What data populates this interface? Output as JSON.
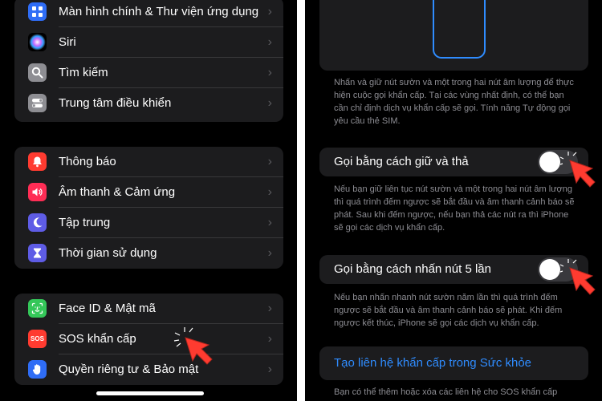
{
  "left_settings": {
    "group1": [
      {
        "label": "Màn hình chính & Thư viện ứng dụng",
        "icon": "home-screen-icon",
        "color": "#2f6df6"
      },
      {
        "label": "Siri",
        "icon": "siri-icon",
        "color": "#000000"
      },
      {
        "label": "Tìm kiếm",
        "icon": "search-icon",
        "color": "#8e8e93"
      },
      {
        "label": "Trung tâm điều khiển",
        "icon": "control-center-icon",
        "color": "#8e8e93"
      }
    ],
    "group2": [
      {
        "label": "Thông báo",
        "icon": "bell-icon",
        "color": "#ff3b30"
      },
      {
        "label": "Âm thanh & Cảm ứng",
        "icon": "speaker-icon",
        "color": "#ff2d55"
      },
      {
        "label": "Tập trung",
        "icon": "moon-icon",
        "color": "#5e5ce6"
      },
      {
        "label": "Thời gian sử dụng",
        "icon": "hourglass-icon",
        "color": "#5e5ce6"
      }
    ],
    "group3": [
      {
        "label": "Face ID & Mật mã",
        "icon": "face-id-icon",
        "color": "#34c759"
      },
      {
        "label": "SOS khẩn cấp",
        "icon": "sos-icon",
        "color": "#ff3b30",
        "icon_text": "SOS"
      },
      {
        "label": "Quyền riêng tư & Bảo mật",
        "icon": "hand-icon",
        "color": "#2f6df6"
      }
    ]
  },
  "emergency_sos": {
    "intro_text": "Nhấn và giữ nút sườn và một trong hai nút âm lượng để thực hiện cuộc gọi khẩn cấp. Tại các vùng nhất định, có thể bạn cần chỉ định dịch vụ khẩn cấp sẽ gọi. Tính năng Tự động gọi yêu cầu thẻ SIM.",
    "hold_release": {
      "label": "Gọi bằng cách giữ và thả",
      "enabled": false,
      "description": "Nếu bạn giữ liên tục nút sườn và một trong hai nút âm lượng thì quá trình đếm ngược sẽ bắt đầu và âm thanh cảnh báo sẽ phát. Sau khi đếm ngược, nếu bạn thả các nút ra thì iPhone sẽ gọi các dịch vụ khẩn cấp."
    },
    "five_presses": {
      "label": "Gọi bằng cách nhấn nút 5 lần",
      "enabled": false,
      "description": "Nếu bạn nhấn nhanh nút sườn năm lần thì quá trình đếm ngược sẽ bắt đầu và âm thanh cảnh báo sẽ phát. Khi đếm ngược kết thúc, iPhone sẽ gọi các dịch vụ khẩn cấp."
    },
    "health_link": "Tạo liên hệ khẩn cấp trong Sức khỏe",
    "footer_text": "Bạn có thể thêm hoặc xóa các liên hệ cho SOS khẩn cấp"
  },
  "colors": {
    "link": "#2f8cff",
    "cursor": "#ff3b30"
  }
}
